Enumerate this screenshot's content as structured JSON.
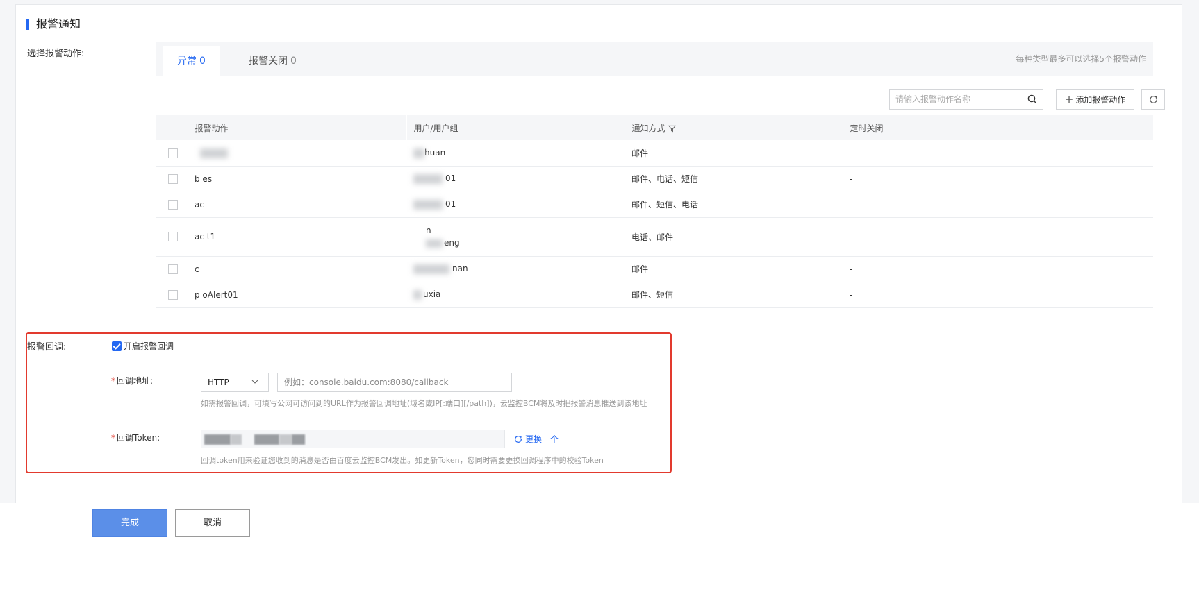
{
  "section": {
    "title": "报警通知"
  },
  "action_label": "选择报警动作:",
  "tabs": [
    {
      "label": "异常",
      "count": "0"
    },
    {
      "label": "报警关闭",
      "count": "0"
    }
  ],
  "limit_note": "每种类型最多可以选择5个报警动作",
  "search": {
    "placeholder": "请输入报警动作名称"
  },
  "add_button": "添加报警动作",
  "table": {
    "headers": [
      "报警动作",
      "用户/用户组",
      "通知方式",
      "定时关闭"
    ],
    "rows": [
      {
        "action": "",
        "user": "huan",
        "user2": "",
        "notify": "邮件",
        "close": "-"
      },
      {
        "action": "b es",
        "user": "01",
        "user2": "",
        "notify": "邮件、电话、短信",
        "close": "-"
      },
      {
        "action": "ac",
        "user": "01",
        "user2": "",
        "notify": "邮件、短信、电话",
        "close": "-"
      },
      {
        "action": "ac t1",
        "user": "n",
        "user2": "eng",
        "notify": "电话、邮件",
        "close": "-"
      },
      {
        "action": "c",
        "user": "nan",
        "user2": "",
        "notify": "邮件",
        "close": "-"
      },
      {
        "action": "p oAlert01",
        "user": "uxia",
        "user2": "",
        "notify": "邮件、短信",
        "close": "-"
      }
    ]
  },
  "callback": {
    "label": "报警回调:",
    "enable_label": "开启报警回调",
    "url_label": "回调地址:",
    "protocol": "HTTP",
    "url_placeholder": "例如：console.baidu.com:8080/callback",
    "url_hint": "如需报警回调，可填写公网可访问到的URL作为报警回调地址(域名或IP[:端口][/path])，云监控BCM将及时把报警消息推送到该地址",
    "token_label": "回调Token:",
    "renew_label": "更换一个",
    "token_hint": "回调token用来验证您收到的消息是否由百度云监控BCM发出。如更新Token，您同时需要更换回调程序中的校验Token"
  },
  "footer": {
    "done": "完成",
    "cancel": "取消"
  },
  "colors": {
    "accent": "#2468f2",
    "highlight": "#e23a2e",
    "primary_button": "#5b8fe8"
  }
}
